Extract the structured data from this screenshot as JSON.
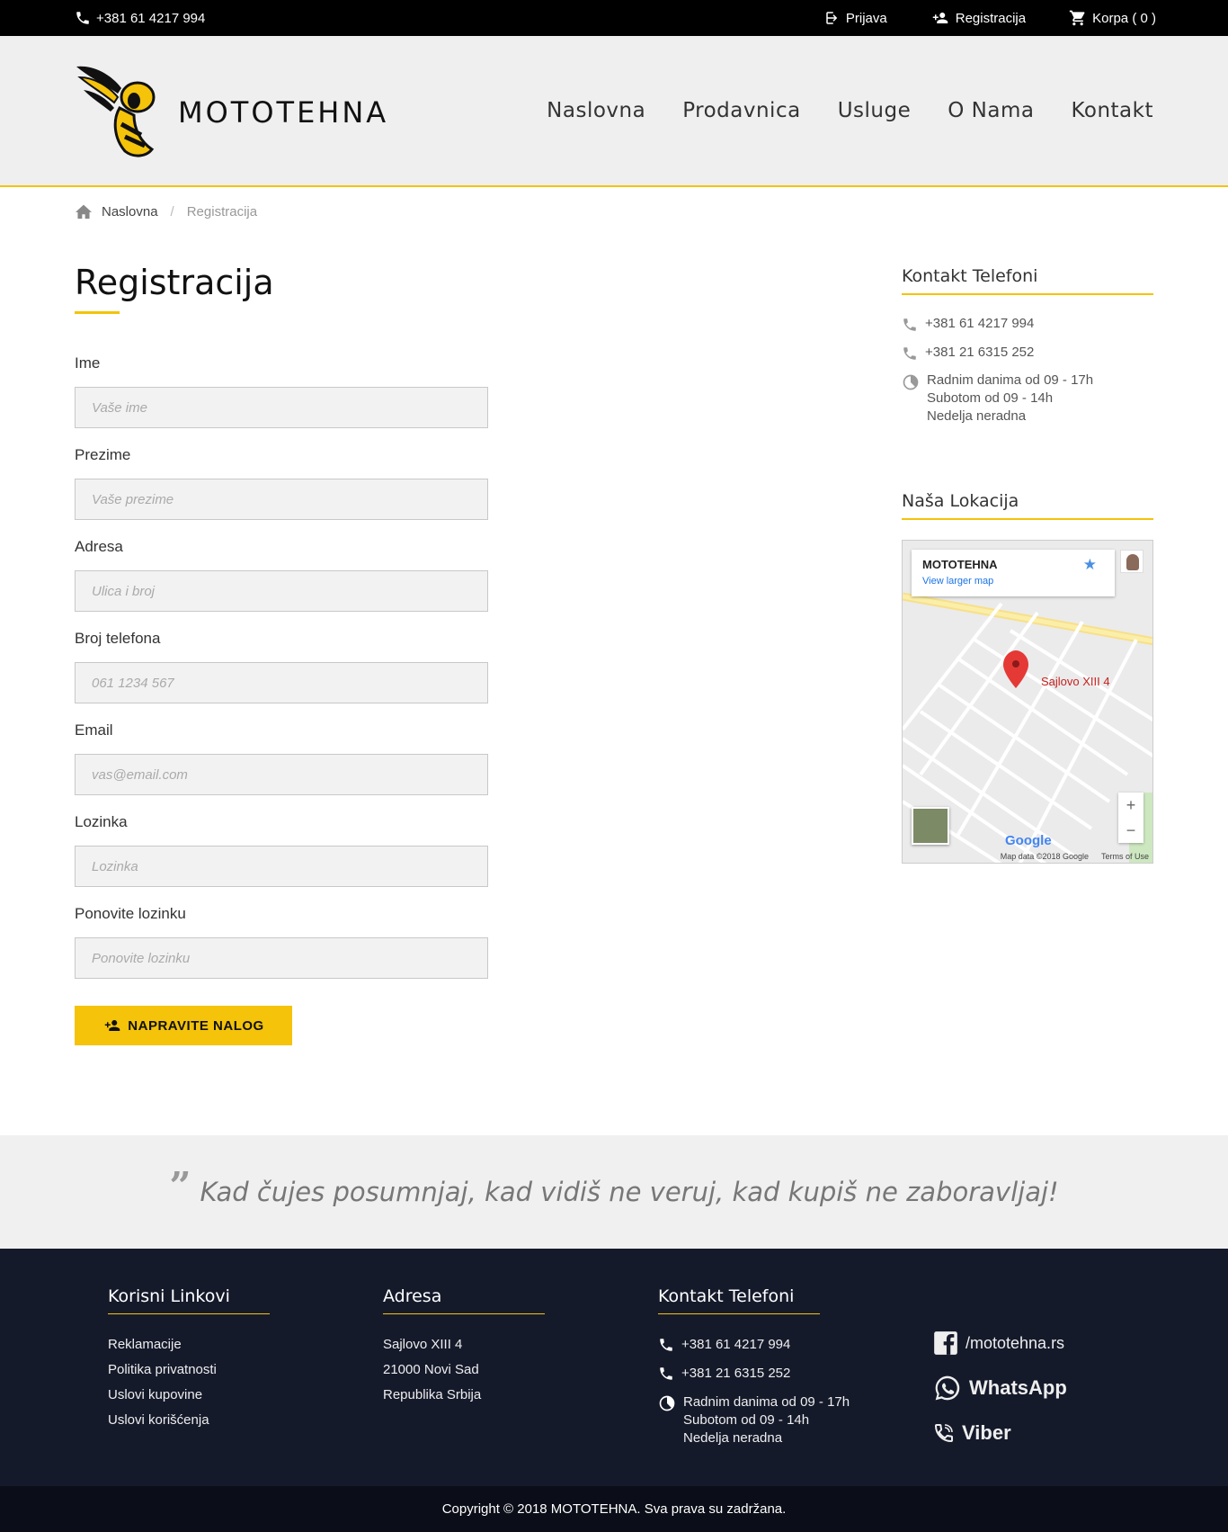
{
  "topbar": {
    "phone": "+381 61 4217 994",
    "login": "Prijava",
    "register": "Registracija",
    "cart": "Korpa ( 0 )"
  },
  "header": {
    "brand": "MOTOTEHNA",
    "nav": [
      "Naslovna",
      "Prodavnica",
      "Usluge",
      "O Nama",
      "Kontakt"
    ]
  },
  "breadcrumb": {
    "home": "Naslovna",
    "current": "Registracija"
  },
  "main": {
    "title": "Registracija",
    "fields": [
      {
        "label": "Ime",
        "placeholder": "Vaše ime"
      },
      {
        "label": "Prezime",
        "placeholder": "Vaše prezime"
      },
      {
        "label": "Adresa",
        "placeholder": "Ulica i broj"
      },
      {
        "label": "Broj telefona",
        "placeholder": "061 1234 567"
      },
      {
        "label": "Email",
        "placeholder": "vas@email.com"
      },
      {
        "label": "Lozinka",
        "placeholder": "Lozinka"
      },
      {
        "label": "Ponovite lozinku",
        "placeholder": "Ponovite lozinku"
      }
    ],
    "submit_label": "NAPRAVITE NALOG"
  },
  "sidebar": {
    "contact_heading": "Kontakt Telefoni",
    "phone1": "+381 61 4217 994",
    "phone2": "+381 21 6315 252",
    "hours1": "Radnim danima od 09 - 17h",
    "hours2": "Subotom od 09 - 14h",
    "hours3": "Nedelja neradna",
    "location_heading": "Naša Lokacija",
    "map": {
      "place_name": "MOTOTEHNA",
      "larger_map_link": "View larger map",
      "marker_label": "Sajlovo XIII 4",
      "google_logo": "Google",
      "map_data": "Map data ©2018 Google",
      "terms": "Terms of Use",
      "zoom_in": "+",
      "zoom_out": "−"
    }
  },
  "quote": {
    "text": "Kad čujes posumnjaj, kad vidiš ne veruj, kad kupiš ne zaboravljaj!"
  },
  "footer": {
    "links_heading": "Korisni Linkovi",
    "links": [
      "Reklamacije",
      "Politika privatnosti",
      "Uslovi kupovine",
      "Uslovi korišćenja"
    ],
    "address_heading": "Adresa",
    "address": [
      "Sajlovo XIII 4",
      "21000 Novi Sad",
      "Republika Srbija"
    ],
    "contact_heading": "Kontakt Telefoni",
    "phone1": "+381 61 4217 994",
    "phone2": "+381 21 6315 252",
    "hours1": "Radnim danima od 09 - 17h",
    "hours2": "Subotom od 09 - 14h",
    "hours3": "Nedelja neradna",
    "facebook": "/mototehna.rs",
    "whatsapp": "WhatsApp",
    "viber": "Viber",
    "copyright": "Copyright © 2018 MOTOTEHNA. Sva prava su zadržana."
  },
  "colors": {
    "accent": "#f4c30a",
    "topbar_bg": "#000000",
    "header_bg": "#efefef",
    "footer_bg": "#151a2b",
    "copyright_bg": "#0b0e18"
  }
}
